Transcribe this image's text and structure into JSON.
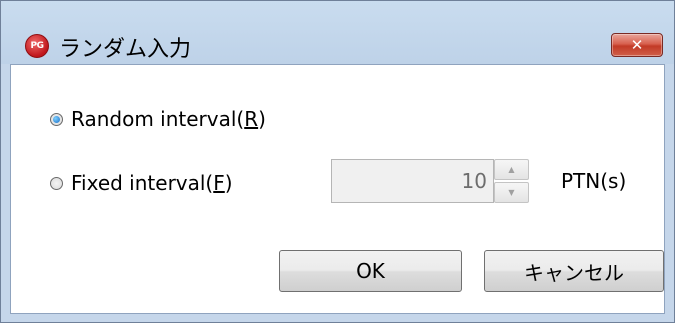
{
  "window": {
    "title": "ランダム入力",
    "app_icon_text": "PG",
    "close_glyph": "✕"
  },
  "options": {
    "random": {
      "label": "Random interval(",
      "mnemonic": "R",
      "close": ")",
      "checked": true
    },
    "fixed": {
      "label": "Fixed interval(",
      "mnemonic": "F",
      "close": ")",
      "checked": false
    }
  },
  "interval": {
    "value": "10",
    "unit": "PTN(s)",
    "up_glyph": "▲",
    "down_glyph": "▼"
  },
  "buttons": {
    "ok": "OK",
    "cancel": "キャンセル"
  },
  "colors": {
    "title_bar": "#c5d6ea",
    "close_button": "#c23a26",
    "radio_checked": "#1a6ec7"
  }
}
